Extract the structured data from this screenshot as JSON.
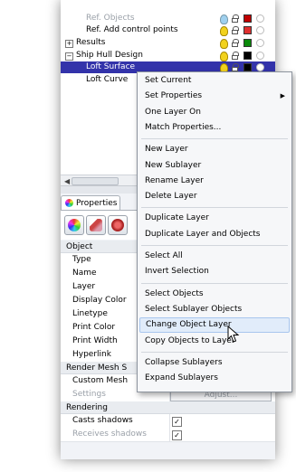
{
  "layers": {
    "rows": [
      {
        "name": "Ref. Objects",
        "faded": true,
        "color": "#c00000"
      },
      {
        "name": "Ref. Add control points",
        "faded": false,
        "color": "#e03030"
      },
      {
        "name": "Results",
        "expander": "+",
        "color": "#0a8a0a"
      },
      {
        "name": "Ship Hull Design",
        "expander": "−",
        "color": "#000000"
      },
      {
        "name": "Loft Surface",
        "selected": true,
        "color": "#000000"
      },
      {
        "name": "Loft Curve",
        "color": "#000000"
      }
    ]
  },
  "properties": {
    "tab_label": "Properties",
    "object_section": "Object",
    "object_rows": [
      "Type",
      "Name",
      "Layer",
      "Display Color",
      "Linetype",
      "Print Color",
      "Print Width",
      "Hyperlink"
    ],
    "render_mesh_section": "Render Mesh S",
    "render_rows": [
      {
        "label": "Custom Mesh",
        "check": ""
      },
      {
        "label": "Settings",
        "faded": true,
        "button": "Adjust..."
      }
    ],
    "rendering_section": "Rendering",
    "rendering_rows": [
      {
        "label": "Casts shadows",
        "check": "✓"
      },
      {
        "label": "Receives shadows",
        "faded": true,
        "check": "✓"
      }
    ]
  },
  "context_menu": {
    "groups": [
      [
        "Set Current",
        "Set Properties",
        "One Layer On",
        "Match Properties..."
      ],
      [
        "New Layer",
        "New Sublayer",
        "Rename Layer",
        "Delete Layer"
      ],
      [
        "Duplicate Layer",
        "Duplicate Layer and Objects"
      ],
      [
        "Select All",
        "Invert Selection"
      ],
      [
        "Select Objects",
        "Select Sublayer Objects",
        "Change Object Layer",
        "Copy Objects to Layer"
      ],
      [
        "Collapse Sublayers",
        "Expand Sublayers"
      ]
    ],
    "submenu_item": "Set Properties",
    "highlighted_item": "Change Object Layer"
  }
}
